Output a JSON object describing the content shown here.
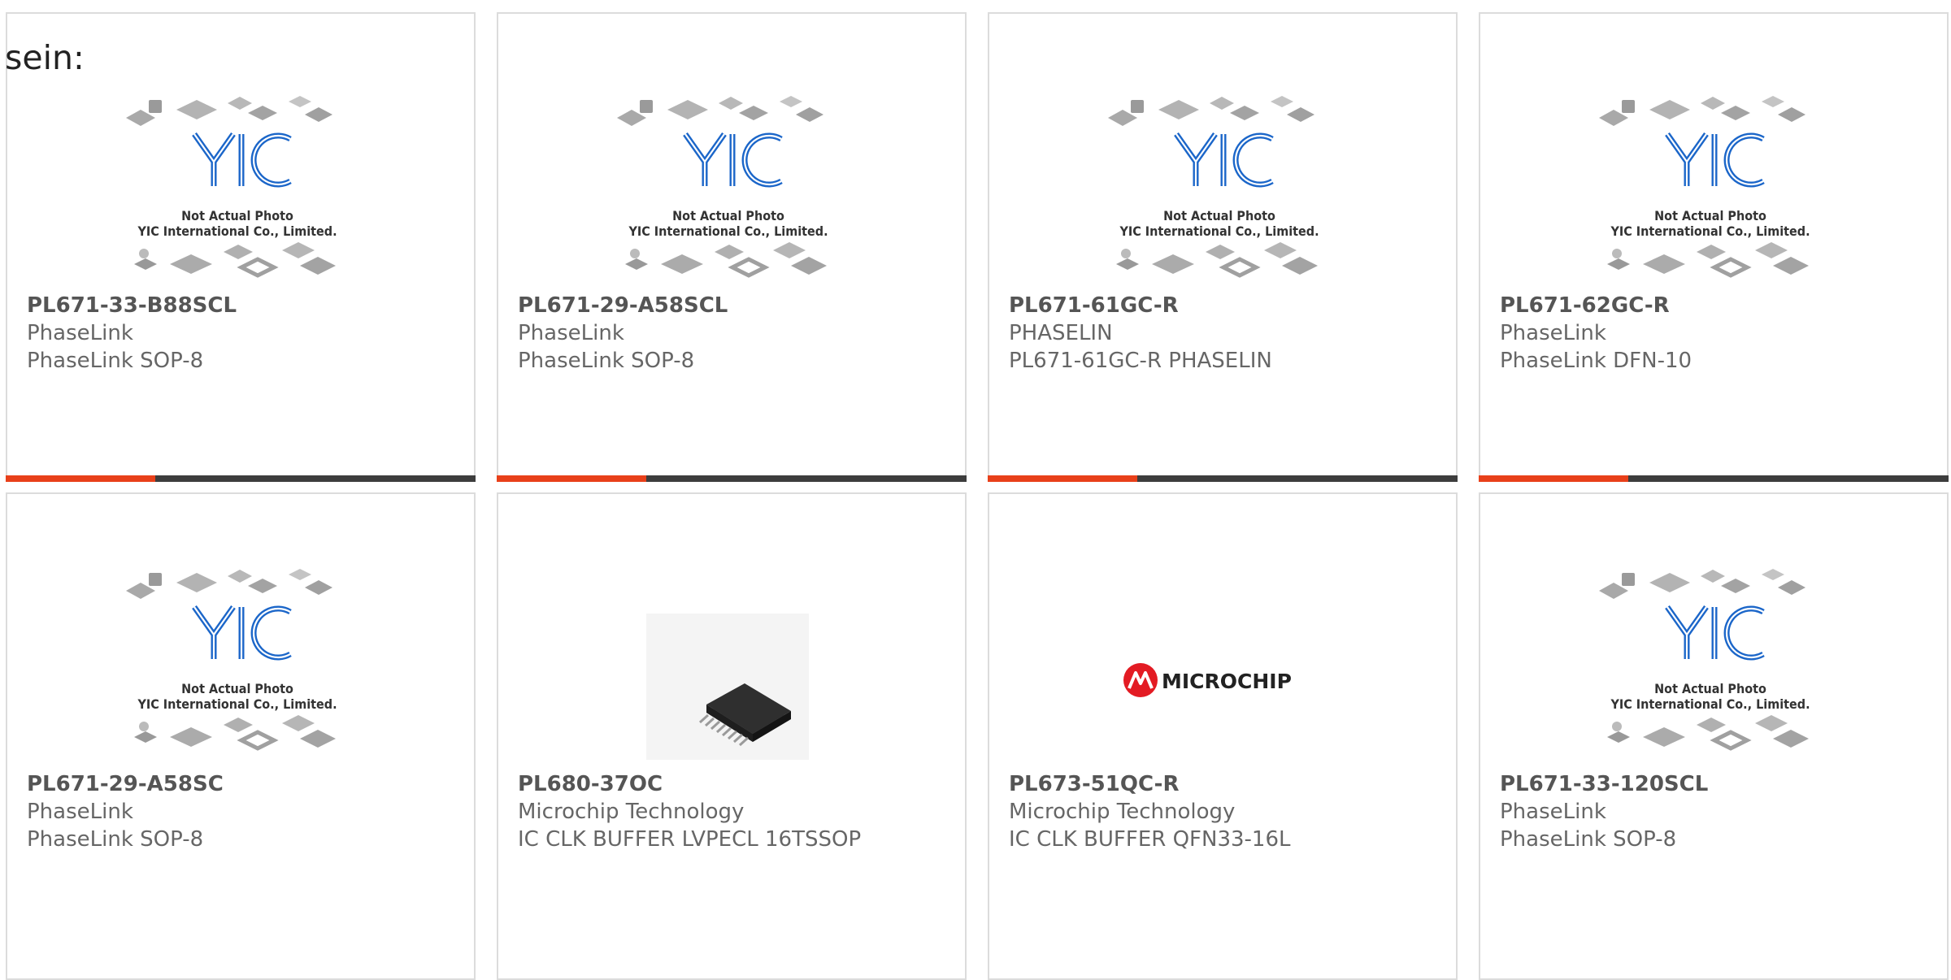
{
  "heading": "sein:",
  "placeholder": {
    "line1": "Not Actual Photo",
    "line2": "YIC International Co., Limited.",
    "logo_letters": "YIC"
  },
  "colors": {
    "accent": "#e8401a",
    "bar": "#3d3d3d",
    "logo_blue": "#1b66c9",
    "border": "#dcdcdc"
  },
  "products": [
    {
      "part": "PL671-33-B88SCL",
      "maker": "PhaseLink",
      "desc": "PhaseLink SOP-8",
      "image": "placeholder-yic"
    },
    {
      "part": "PL671-29-A58SCL",
      "maker": "PhaseLink",
      "desc": "PhaseLink SOP-8",
      "image": "placeholder-yic"
    },
    {
      "part": "PL671-61GC-R",
      "maker": "PHASELIN",
      "desc": "PL671-61GC-R PHASELIN",
      "image": "placeholder-yic"
    },
    {
      "part": "PL671-62GC-R",
      "maker": "PhaseLink",
      "desc": "PhaseLink DFN-10",
      "image": "placeholder-yic"
    },
    {
      "part": "PL671-29-A58SC",
      "maker": "PhaseLink",
      "desc": "PhaseLink SOP-8",
      "image": "placeholder-yic"
    },
    {
      "part": "PL680-37OC",
      "maker": "Microchip Technology",
      "desc": "IC CLK BUFFER LVPECL 16TSSOP",
      "image": "chip-photo"
    },
    {
      "part": "PL673-51QC-R",
      "maker": "Microchip Technology",
      "desc": "IC CLK BUFFER QFN33-16L",
      "image": "microchip-logo",
      "logo_text": "MICROCHIP"
    },
    {
      "part": "PL671-33-120SCL",
      "maker": "PhaseLink",
      "desc": "PhaseLink SOP-8",
      "image": "placeholder-yic"
    }
  ]
}
